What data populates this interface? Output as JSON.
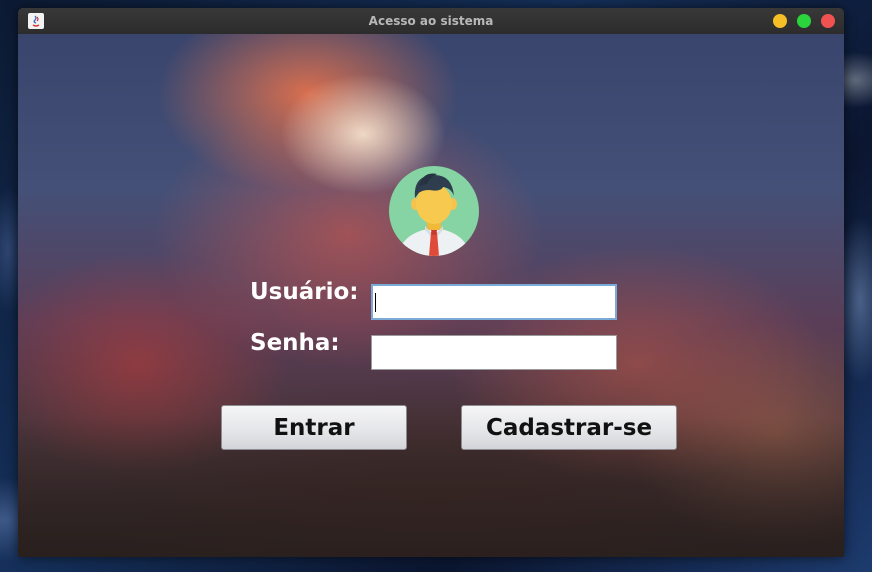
{
  "window": {
    "title": "Acesso ao sistema"
  },
  "form": {
    "user_label": "Usuário:",
    "user_value": "",
    "password_label": "Senha:",
    "password_value": ""
  },
  "buttons": {
    "enter_label": "Entrar",
    "register_label": "Cadastrar-se"
  },
  "icons": {
    "app": "java-app-icon",
    "avatar": "user-avatar-icon"
  },
  "colors": {
    "minimize": "#f5be27",
    "maximize": "#2bd33c",
    "close": "#f05252"
  }
}
